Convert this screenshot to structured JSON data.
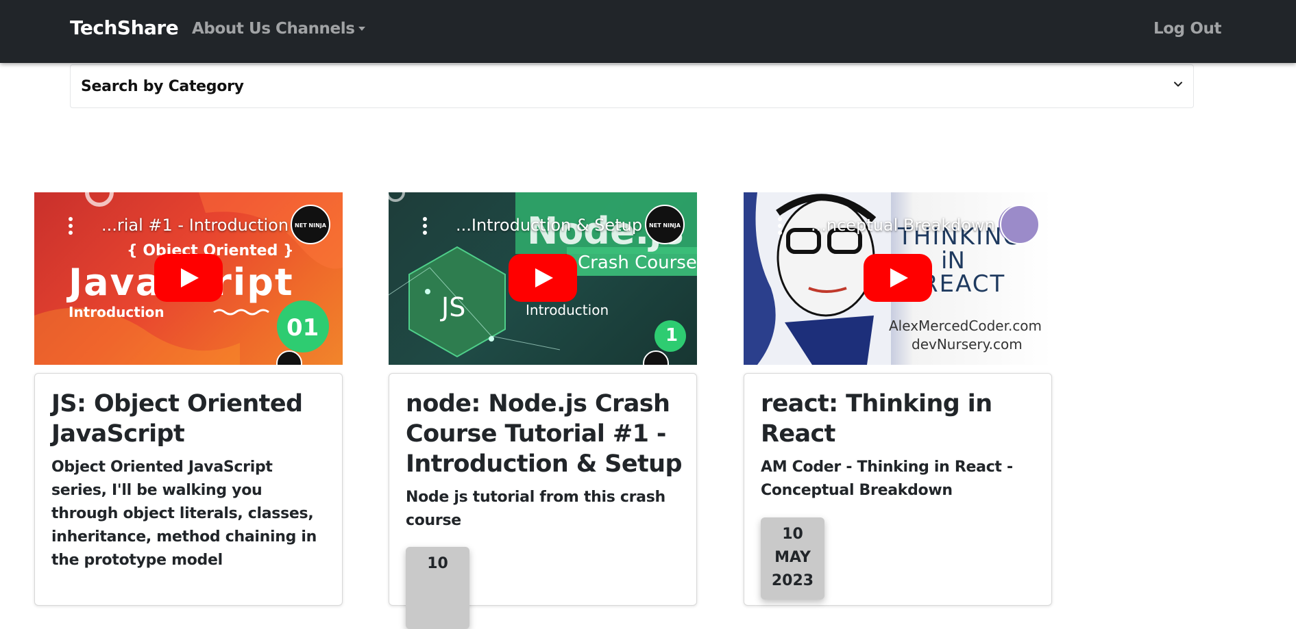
{
  "navbar": {
    "brand": "TechShare",
    "links": {
      "about": "About Us",
      "channels": "Channels",
      "logout": "Log Out"
    }
  },
  "search": {
    "label": "Search by Category"
  },
  "cards": [
    {
      "video_title": "...rial #1 - Introduction",
      "channel_logo_text": "NET NINJA",
      "thumbnail_text": [
        "{ Object Oriented }",
        "JavaScript",
        "Introduction",
        "01"
      ],
      "title": "JS: Object Oriented JavaScript",
      "description": "Object Oriented JavaScript series, I'll be walking you through object literals, classes, inheritance, method chaining in the prototype model",
      "date": {
        "day": "",
        "month": "",
        "year": ""
      }
    },
    {
      "video_title": "...Introduction & Setup",
      "channel_logo_text": "NET NINJA",
      "thumbnail_text": [
        "Node.js",
        "Crash Course",
        "JS",
        "Introduction",
        "1"
      ],
      "title": "node: Node.js Crash Course Tutorial #1 - Introduction & Setup",
      "description": "Node js tutorial from this crash course",
      "date": {
        "day": "10",
        "month": "",
        "year": ""
      }
    },
    {
      "video_title": "...nceptual Breakdown",
      "channel_logo_text": "",
      "thumbnail_text": [
        "THINKING",
        "iN",
        "REACT",
        "AlexMercedCoder.com",
        "devNursery.com"
      ],
      "title": "react: Thinking in React",
      "description": "AM Coder - Thinking in React - Conceptual Breakdown",
      "date": {
        "day": "10",
        "month": "MAY",
        "year": "2023"
      }
    }
  ],
  "colors": {
    "navbar_bg": "#212529",
    "youtube_red": "#ff0000",
    "date_badge_bg": "#c9c9c9"
  }
}
